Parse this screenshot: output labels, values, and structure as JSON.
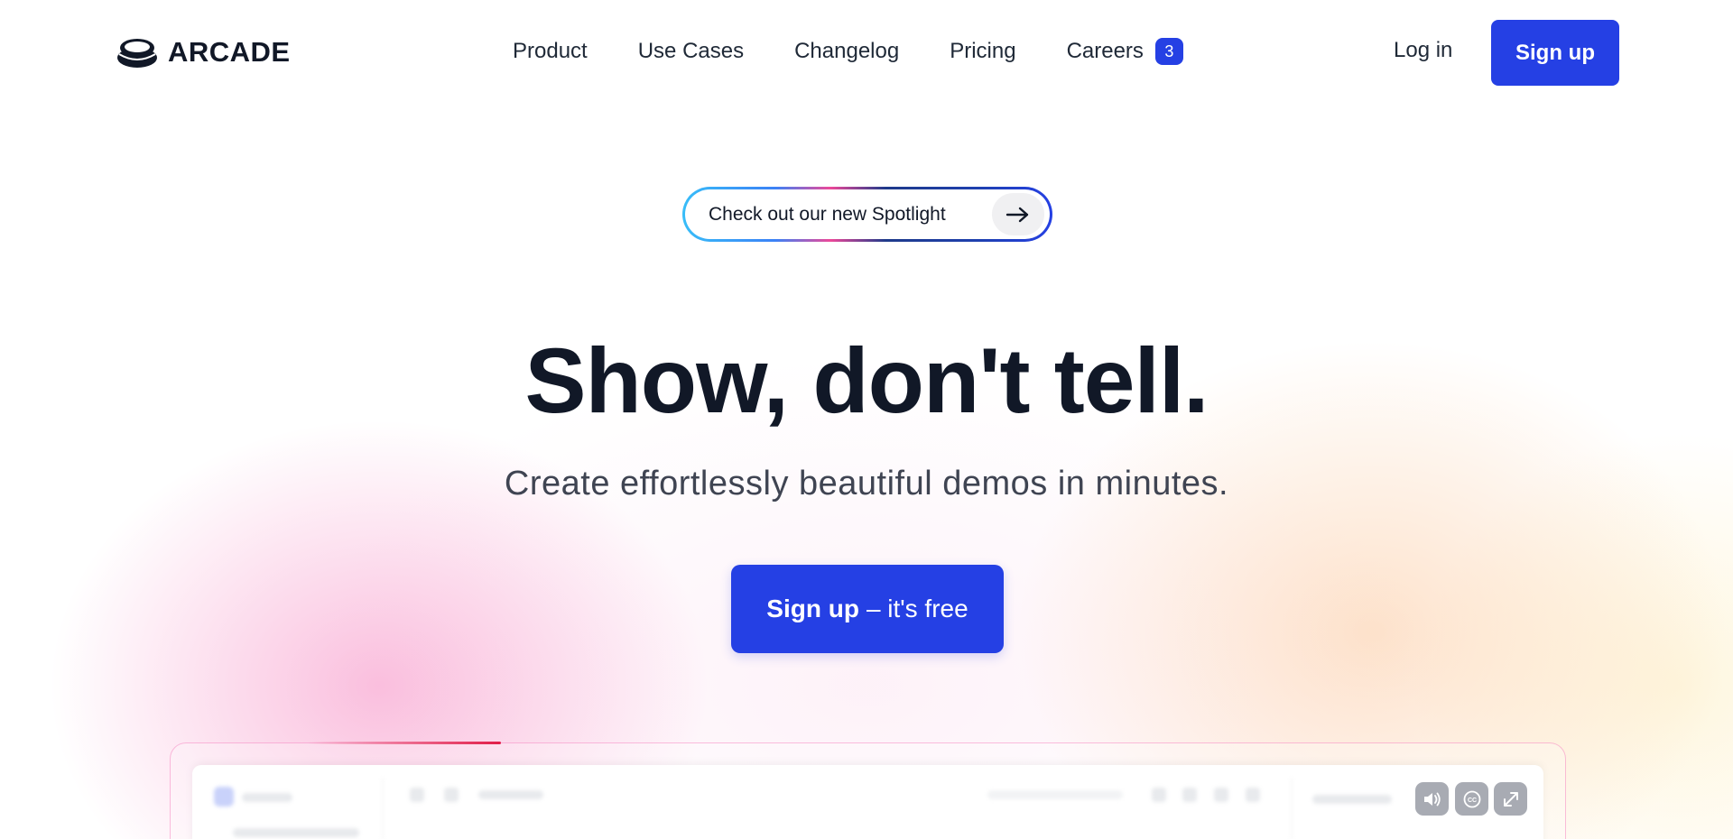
{
  "brand": {
    "name": "ARCADE"
  },
  "nav": {
    "links": [
      {
        "label": "Product"
      },
      {
        "label": "Use Cases"
      },
      {
        "label": "Changelog"
      },
      {
        "label": "Pricing"
      },
      {
        "label": "Careers",
        "badge": "3"
      }
    ],
    "login_label": "Log in",
    "signup_label": "Sign up"
  },
  "spotlight": {
    "label": "Check out our new Spotlight",
    "icon": "arrow-right-icon"
  },
  "hero": {
    "title": "Show, don't tell.",
    "subtitle": "Create effortlessly beautiful demos in minutes.",
    "cta_strong": "Sign up",
    "cta_rest": "– it's free"
  },
  "demo": {
    "controls": [
      "volume-icon",
      "closed-captions-icon",
      "fullscreen-icon"
    ]
  },
  "colors": {
    "accent": "#2540e4",
    "text": "#111827",
    "subtext": "#3f4452"
  }
}
